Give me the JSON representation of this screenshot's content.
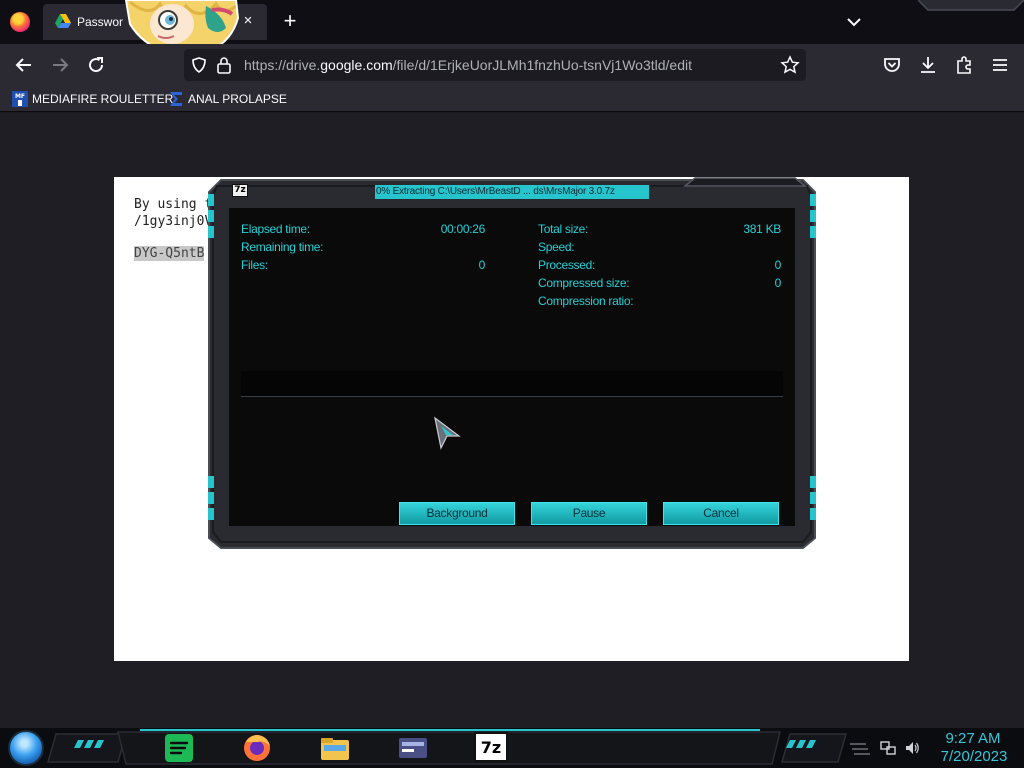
{
  "browser": {
    "tab_title": "Passwor",
    "tab_close": "×",
    "new_tab": "+",
    "url_prefix": "https://drive.",
    "url_domain": "google.com",
    "url_path": "/file/d/1ErjkeUorJLMh1fnzhUo-tsnVj1Wo3tld/edit",
    "bookmarks": [
      {
        "label": "MEDIAFIRE ROULETTER",
        "icon": "mediafire-icon",
        "icon_text": "MF"
      },
      {
        "label": "ANAL PROLAPSE",
        "icon": "sigma-icon"
      }
    ]
  },
  "document": {
    "line1": "By using t",
    "line2": "/1gy3inj0V",
    "line3": "DYG-Q5ntB"
  },
  "dialog": {
    "title": "0% Extracting C:\\Users\\MrBeastD ... ds\\MrsMajor 3.0.7z",
    "icon_text": "7z",
    "left": [
      {
        "label": "Elapsed time:",
        "value": "00:00:26"
      },
      {
        "label": "Remaining time:",
        "value": ""
      },
      {
        "label": "Files:",
        "value": "0"
      }
    ],
    "right": [
      {
        "label": "Total size:",
        "value": "381 KB"
      },
      {
        "label": "Speed:",
        "value": ""
      },
      {
        "label": "Processed:",
        "value": "0"
      },
      {
        "label": "Compressed size:",
        "value": "0"
      },
      {
        "label": "Compression ratio:",
        "value": ""
      }
    ],
    "progress": 0,
    "buttons": {
      "background": "Background",
      "pause": "Pause",
      "cancel": "Cancel"
    }
  },
  "taskbar": {
    "time": "9:27 AM",
    "date": "7/20/2023",
    "apps": [
      "spotify-icon",
      "firefox-icon",
      "file-explorer-icon",
      "control-panel-icon",
      "7zip-icon"
    ],
    "sevenzip_text": "7z"
  },
  "colors": {
    "accent": "#26d0d6",
    "dialog_bg": "#0a0a0a",
    "browser_toolbar": "#2b2a33"
  }
}
